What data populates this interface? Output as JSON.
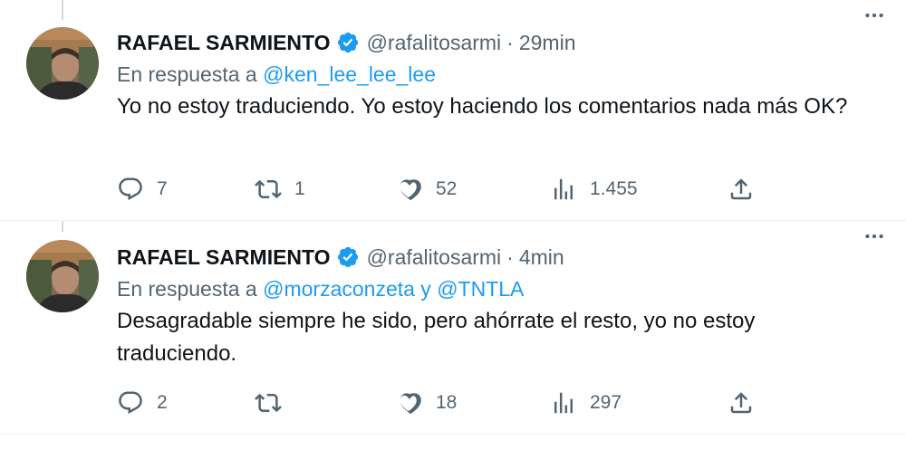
{
  "tweets": [
    {
      "author_name": "RAFAEL SARMIENTO",
      "handle": "@rafalitosarmi",
      "separator": "·",
      "time": "29min",
      "reply_prefix": "En respuesta a",
      "reply_mentions": "@ken_lee_lee_lee",
      "text": "Yo no estoy traduciendo. Yo estoy haciendo los comentarios nada más OK?",
      "replies": "7",
      "retweets": "1",
      "likes": "52",
      "views": "1.455"
    },
    {
      "author_name": "RAFAEL SARMIENTO",
      "handle": "@rafalitosarmi",
      "separator": "·",
      "time": "4min",
      "reply_prefix": "En respuesta a",
      "reply_mentions": "@morzaconzeta y @TNTLA",
      "text": "Desagradable siempre he sido, pero ahórrate el resto, yo no estoy traduciendo.",
      "replies": "2",
      "retweets": "",
      "likes": "18",
      "views": "297"
    }
  ],
  "colors": {
    "text_primary": "#0f1419",
    "text_secondary": "#536471",
    "link": "#1d9bf0",
    "verified": "#1d9bf0",
    "divider": "#eff3f4"
  },
  "icons": [
    "verified-badge-icon",
    "more-icon",
    "reply-icon",
    "retweet-icon",
    "like-icon",
    "views-icon",
    "share-icon"
  ]
}
